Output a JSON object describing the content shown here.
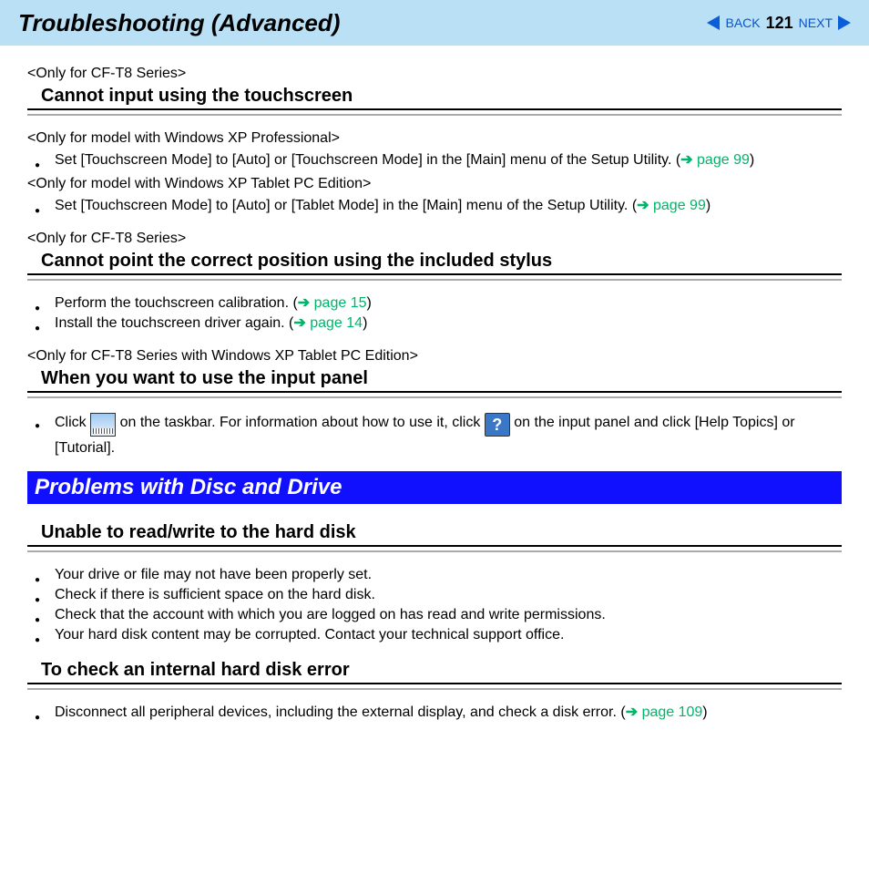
{
  "header": {
    "title": "Troubleshooting (Advanced)",
    "back": "BACK",
    "page": "121",
    "next": "NEXT"
  },
  "s1": {
    "note": "<Only for CF-T8 Series>",
    "head": "Cannot input using the touchscreen",
    "note2": "<Only for model with Windows XP Professional>",
    "b1a": "Set [Touchscreen Mode] to [Auto] or [Touchscreen Mode] in the [Main] menu of the Setup Utility. (",
    "b1l": "page 99",
    "b1b": ")",
    "note3": "<Only for model with Windows XP Tablet PC Edition>",
    "b2a": "Set [Touchscreen Mode] to [Auto] or [Tablet Mode] in the [Main] menu of the Setup Utility. (",
    "b2l": "page 99",
    "b2b": ")"
  },
  "s2": {
    "note": "<Only for CF-T8 Series>",
    "head": "Cannot point the correct position using the included stylus",
    "b1a": "Perform the touchscreen calibration. (",
    "b1l": "page 15",
    "b1b": ")",
    "b2a": "Install the touchscreen driver again. (",
    "b2l": "page 14",
    "b2b": ")"
  },
  "s3": {
    "note": "<Only for CF-T8 Series with Windows XP Tablet PC Edition>",
    "head": "When you want to use the input panel",
    "p1": "Click",
    "p2": "on the taskbar. For information about how to use it, click",
    "p3": "on the input panel and click [Help Topics] or",
    "p4": "[Tutorial]."
  },
  "band": "Problems with Disc and Drive",
  "s4": {
    "head": "Unable to read/write to the hard disk",
    "b1": "Your drive or file may not have been properly set.",
    "b2": "Check if there is sufficient space on the hard disk.",
    "b3": "Check that the account with which you are logged on has read and write permissions.",
    "b4": "Your hard disk content may be corrupted.   Contact your technical support office."
  },
  "s5": {
    "head": "To check an internal hard disk error",
    "b1a": "Disconnect all peripheral devices, including the external display, and check a disk error. (",
    "b1l": "page 109",
    "b1b": ")"
  }
}
